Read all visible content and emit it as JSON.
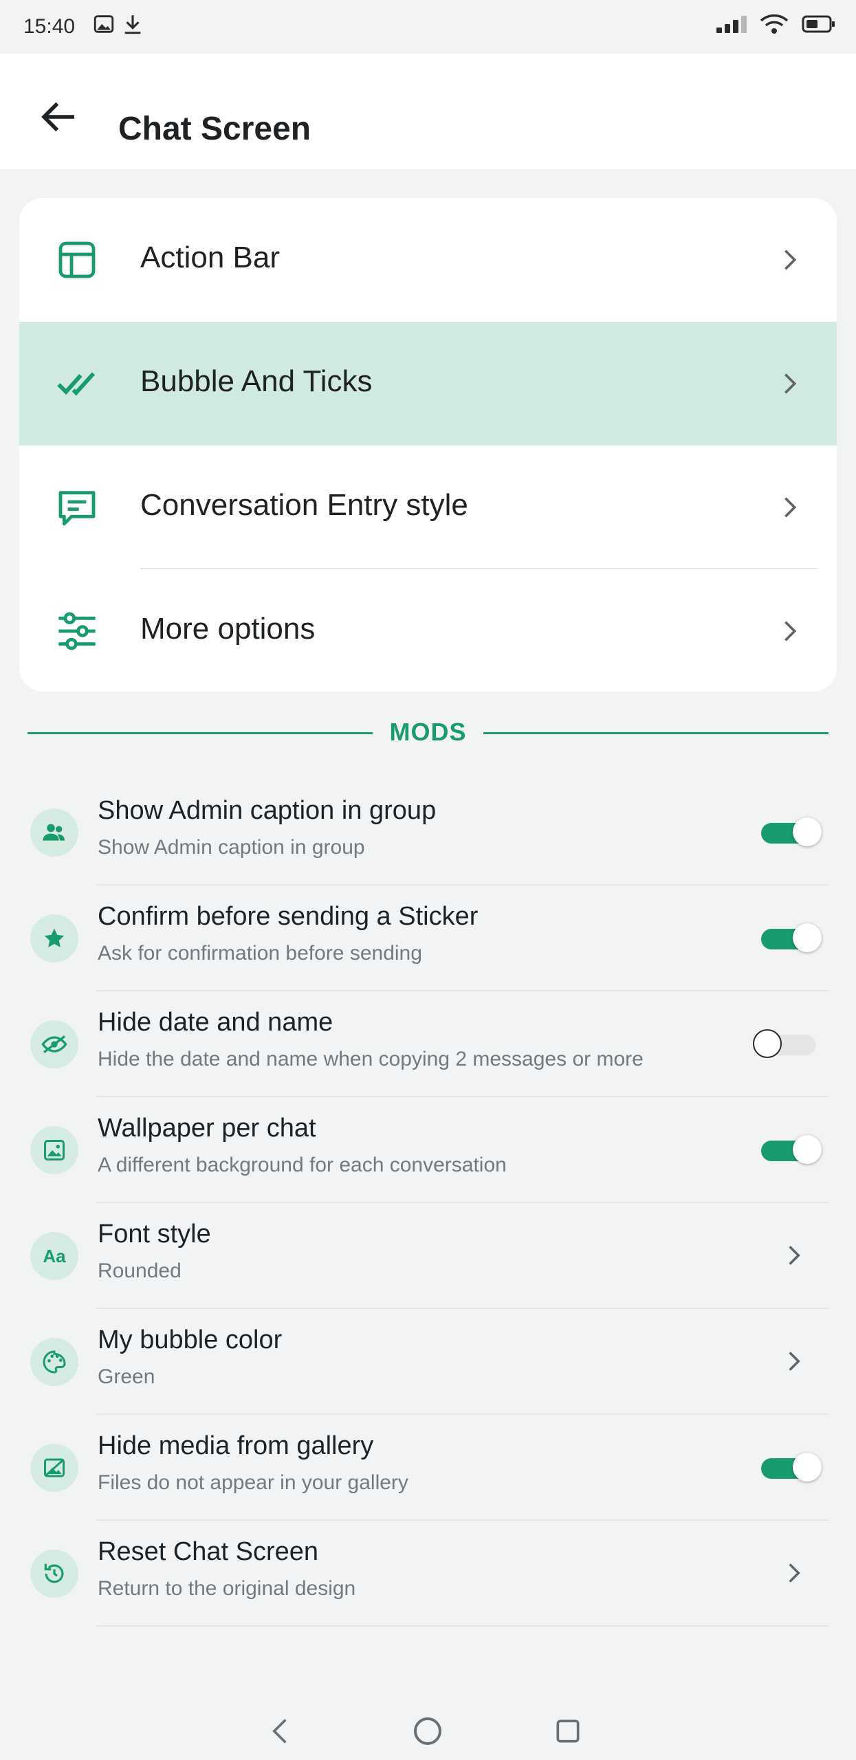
{
  "status_bar": {
    "time": "15:40",
    "left_icons": [
      "image-icon",
      "download-icon"
    ],
    "right_icons": [
      "signal-icon",
      "wifi-icon",
      "battery-icon"
    ]
  },
  "header": {
    "back_icon": "arrow-left-icon",
    "title": "Chat Screen"
  },
  "menu": {
    "items": [
      {
        "label": "Action Bar",
        "icon": "layout-icon"
      },
      {
        "label": "Bubble And Ticks",
        "icon": "double-check-icon",
        "selected": true
      },
      {
        "label": "Conversation Entry style",
        "icon": "message-icon"
      },
      {
        "label": "More options",
        "icon": "sliders-icon"
      }
    ]
  },
  "mods": {
    "title": "MODS",
    "items": [
      {
        "title": "Show Admin caption in group",
        "subtitle": "Show Admin caption in group",
        "icon": "people-icon",
        "control": "toggle",
        "value": true
      },
      {
        "title": "Confirm before sending a Sticker",
        "subtitle": "Ask for confirmation before sending",
        "icon": "star-icon",
        "control": "toggle",
        "value": true
      },
      {
        "title": "Hide date and name",
        "subtitle": "Hide the date and name when copying 2 messages or more",
        "icon": "eye-off-icon",
        "control": "toggle",
        "value": false
      },
      {
        "title": "Wallpaper per chat",
        "subtitle": "A different background for each conversation",
        "icon": "image-icon",
        "control": "toggle",
        "value": true
      },
      {
        "title": "Font style",
        "subtitle": "Rounded",
        "icon": "font-icon",
        "icon_text": "Aa",
        "control": "chevron"
      },
      {
        "title": "My bubble color",
        "subtitle": "Green",
        "icon": "palette-icon",
        "control": "chevron"
      },
      {
        "title": "Hide media from gallery",
        "subtitle": "Files do not appear in your gallery",
        "icon": "gallery-off-icon",
        "control": "toggle",
        "value": true
      },
      {
        "title": "Reset Chat Screen",
        "subtitle": "Return to the original design",
        "icon": "reset-icon",
        "control": "chevron"
      }
    ]
  },
  "nav_bar": {
    "buttons": [
      "back-nav-icon",
      "home-nav-icon",
      "recents-nav-icon"
    ]
  },
  "colors": {
    "accent": "#1a9b6d",
    "selected_row": "#d1eae1",
    "icon_circle": "#d6ece2",
    "background": "#f1f3f4"
  }
}
